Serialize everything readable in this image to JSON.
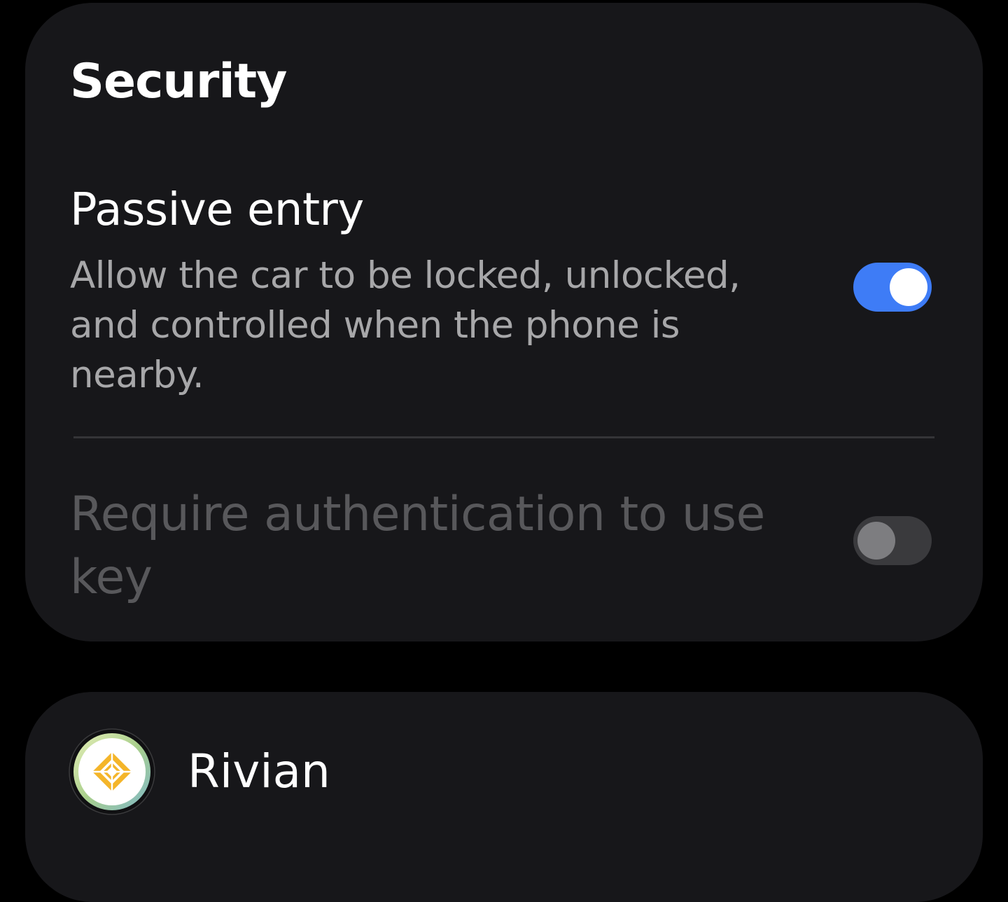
{
  "security": {
    "title": "Security",
    "passive_entry": {
      "title": "Passive entry",
      "description": "Allow the car to be locked, unlocked, and controlled when the phone is nearby.",
      "enabled": true
    },
    "require_auth": {
      "title": "Require authentication to use key",
      "enabled": false,
      "disabled": true
    }
  },
  "app": {
    "name": "Rivian",
    "icon": "rivian-logo-icon"
  },
  "colors": {
    "accent": "#3e7cf6",
    "card_background": "#17171a",
    "page_background": "#000000",
    "icon_gold": "#f4b52a"
  }
}
